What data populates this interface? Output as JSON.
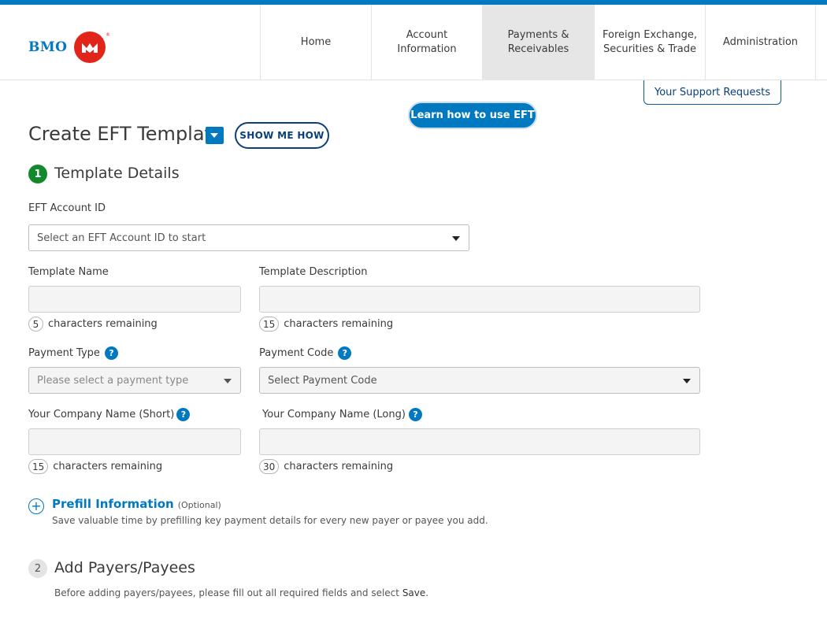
{
  "brand": {
    "name": "BMO",
    "reg_mark": "®"
  },
  "nav": {
    "items": [
      {
        "label": "Home"
      },
      {
        "label": "Account\nInformation"
      },
      {
        "label": "Payments &\nReceivables"
      },
      {
        "label": "Foreign Exchange,\nSecurities & Trade"
      },
      {
        "label": "Administration"
      }
    ],
    "active_index": 2
  },
  "support": {
    "label": "Your Support Requests"
  },
  "learn": {
    "label": "Learn how to use EFT"
  },
  "page": {
    "title": "Create EFT Template",
    "show_me_how": "SHOW ME HOW"
  },
  "step1": {
    "number": "1",
    "title": "Template Details"
  },
  "form": {
    "eft_account": {
      "label": "EFT Account ID",
      "selected": "Select an EFT Account ID to start"
    },
    "template_name": {
      "label": "Template Name",
      "value": "",
      "remaining": "5",
      "remaining_text": "characters remaining"
    },
    "template_description": {
      "label": "Template Description",
      "value": "",
      "remaining": "15",
      "remaining_text": "characters remaining"
    },
    "payment_type": {
      "label": "Payment Type",
      "selected": "Please select a payment type"
    },
    "payment_code": {
      "label": "Payment Code",
      "selected": "Select Payment Code"
    },
    "company_short": {
      "label": "Your Company Name (Short)",
      "value": "",
      "remaining": "15",
      "remaining_text": "characters remaining"
    },
    "company_long": {
      "label": "Your Company Name (Long)",
      "value": "",
      "remaining": "30",
      "remaining_text": "characters remaining"
    },
    "help_glyph": "?"
  },
  "prefill": {
    "title": "Prefill Information",
    "optional": "(Optional)",
    "description": "Save valuable time by prefilling key payment details for every new payer or payee you add.",
    "icon": "plus-circle-icon"
  },
  "step2": {
    "number": "2",
    "title": "Add Payers/Payees",
    "description": "Before adding payers/payees, please fill out all required fields and select ",
    "description_bold": "Save",
    "description_end": "."
  },
  "colors": {
    "brand_blue": "#0079c1",
    "navy": "#0a3f7a",
    "brand_red": "#e1251b",
    "step_green": "#128a2c"
  }
}
